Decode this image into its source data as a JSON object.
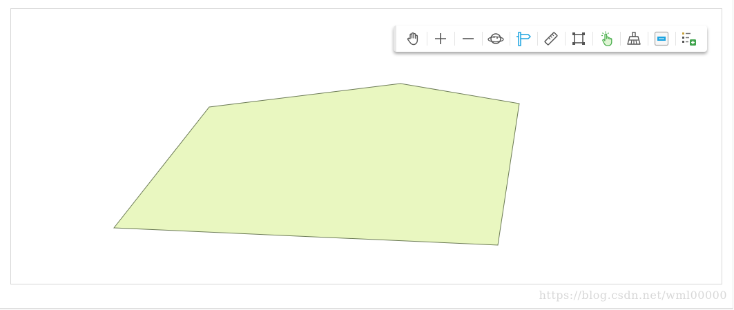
{
  "map": {
    "polygon_fill": "#e9f7c0",
    "polygon_stroke": "#6b7a55"
  },
  "toolbar": {
    "tools": [
      {
        "name": "pan-tool-button",
        "icon": "hand-icon"
      },
      {
        "name": "zoom-in-button",
        "icon": "plus-icon"
      },
      {
        "name": "zoom-out-button",
        "icon": "minus-icon"
      },
      {
        "name": "full-extent-button",
        "icon": "globe-icon"
      },
      {
        "name": "navigation-button",
        "icon": "signpost-icon"
      },
      {
        "name": "measure-button",
        "icon": "ruler-icon"
      },
      {
        "name": "select-extent-button",
        "icon": "frame-icon"
      },
      {
        "name": "identify-button",
        "icon": "pointer-click-icon"
      },
      {
        "name": "clear-button",
        "icon": "broom-icon"
      },
      {
        "name": "window-button",
        "icon": "window-icon"
      },
      {
        "name": "layer-list-button",
        "icon": "layer-add-icon"
      }
    ],
    "accent_color": "#1aa3e0",
    "icon_color": "#555555"
  },
  "watermark": {
    "text": "https://blog.csdn.net/wml00000"
  }
}
